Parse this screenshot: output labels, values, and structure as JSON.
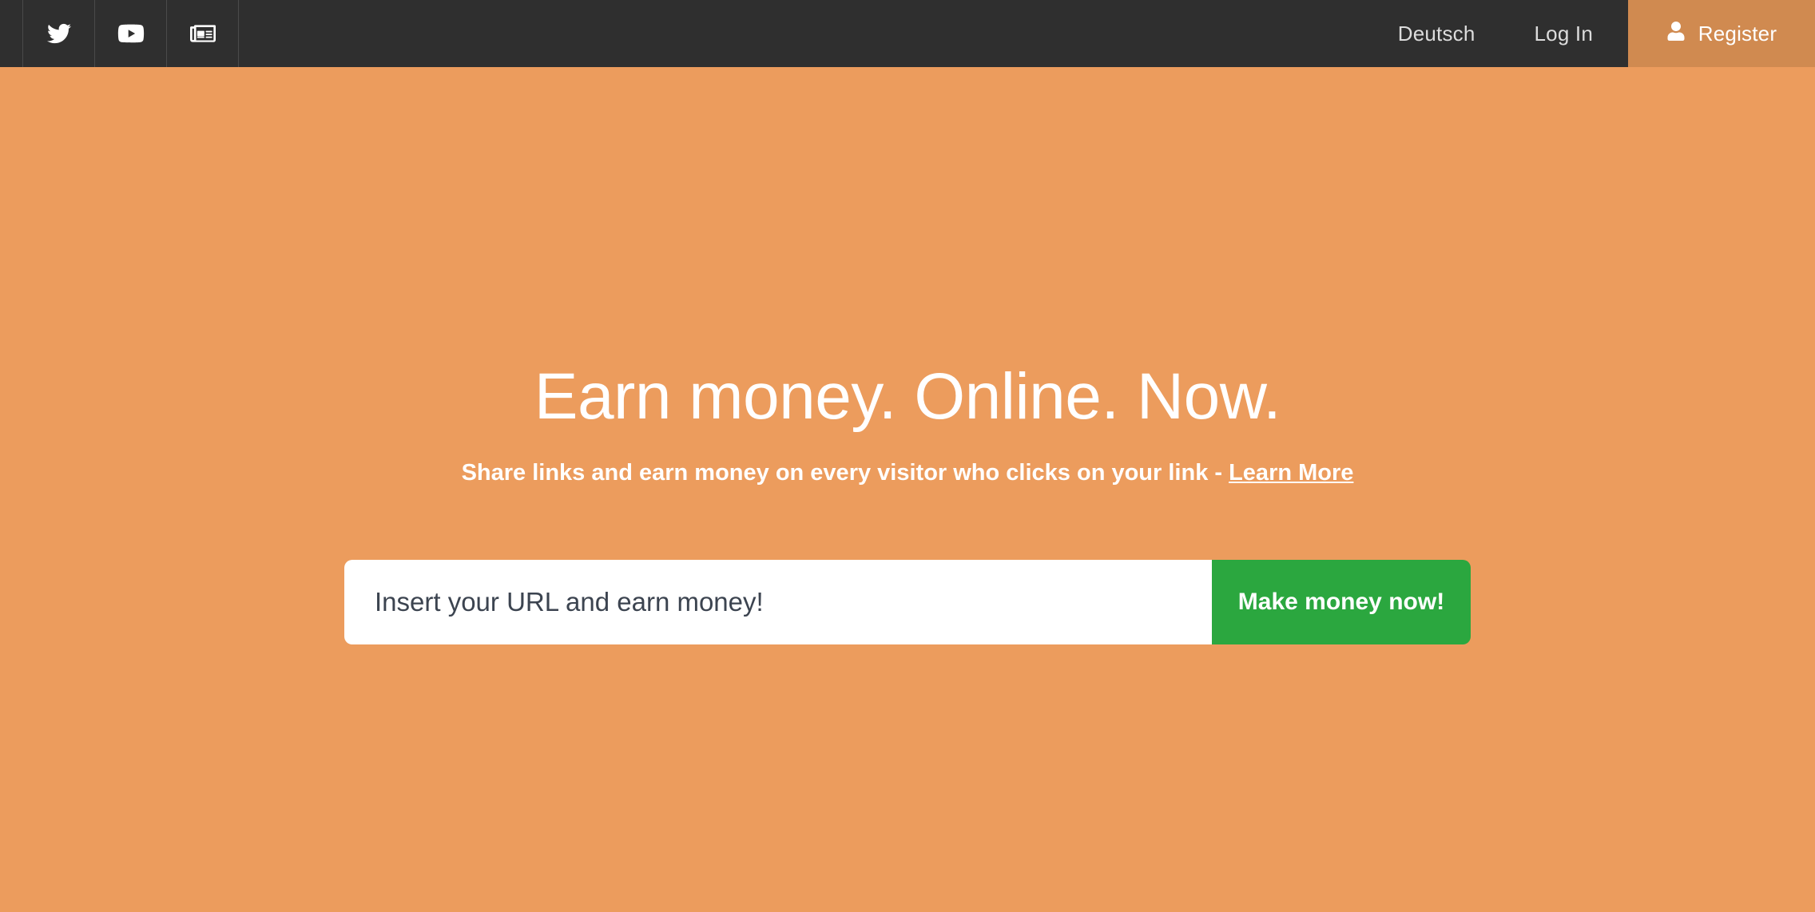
{
  "theme": {
    "header_bg": "#2F2F2F",
    "header_divider": "#4A4A4A",
    "page_bg": "#EC9C5D",
    "register_bg": "#D08A50",
    "button_green": "#2BA73F",
    "text_light": "#DCDCDC",
    "input_text": "#3C4450",
    "white": "#FFFFFF"
  },
  "header": {
    "social": [
      {
        "name": "twitter-icon",
        "label": "Twitter"
      },
      {
        "name": "youtube-icon",
        "label": "YouTube"
      },
      {
        "name": "news-icon",
        "label": "News"
      }
    ],
    "language": {
      "label": "Deutsch",
      "flag": "flag-de-icon",
      "flag_colors": [
        "#000000",
        "#DD0000",
        "#FFCE00"
      ]
    },
    "login_label": "Log In",
    "register_label": "Register",
    "register_icon": "user-icon"
  },
  "hero": {
    "headline": "Earn money. Online. Now.",
    "subline_text": "Share links and earn money on every visitor who clicks on your link - ",
    "subline_link": "Learn More"
  },
  "form": {
    "input_value": "",
    "input_placeholder": "Insert your URL and earn money!",
    "submit_label": "Make money now!"
  }
}
